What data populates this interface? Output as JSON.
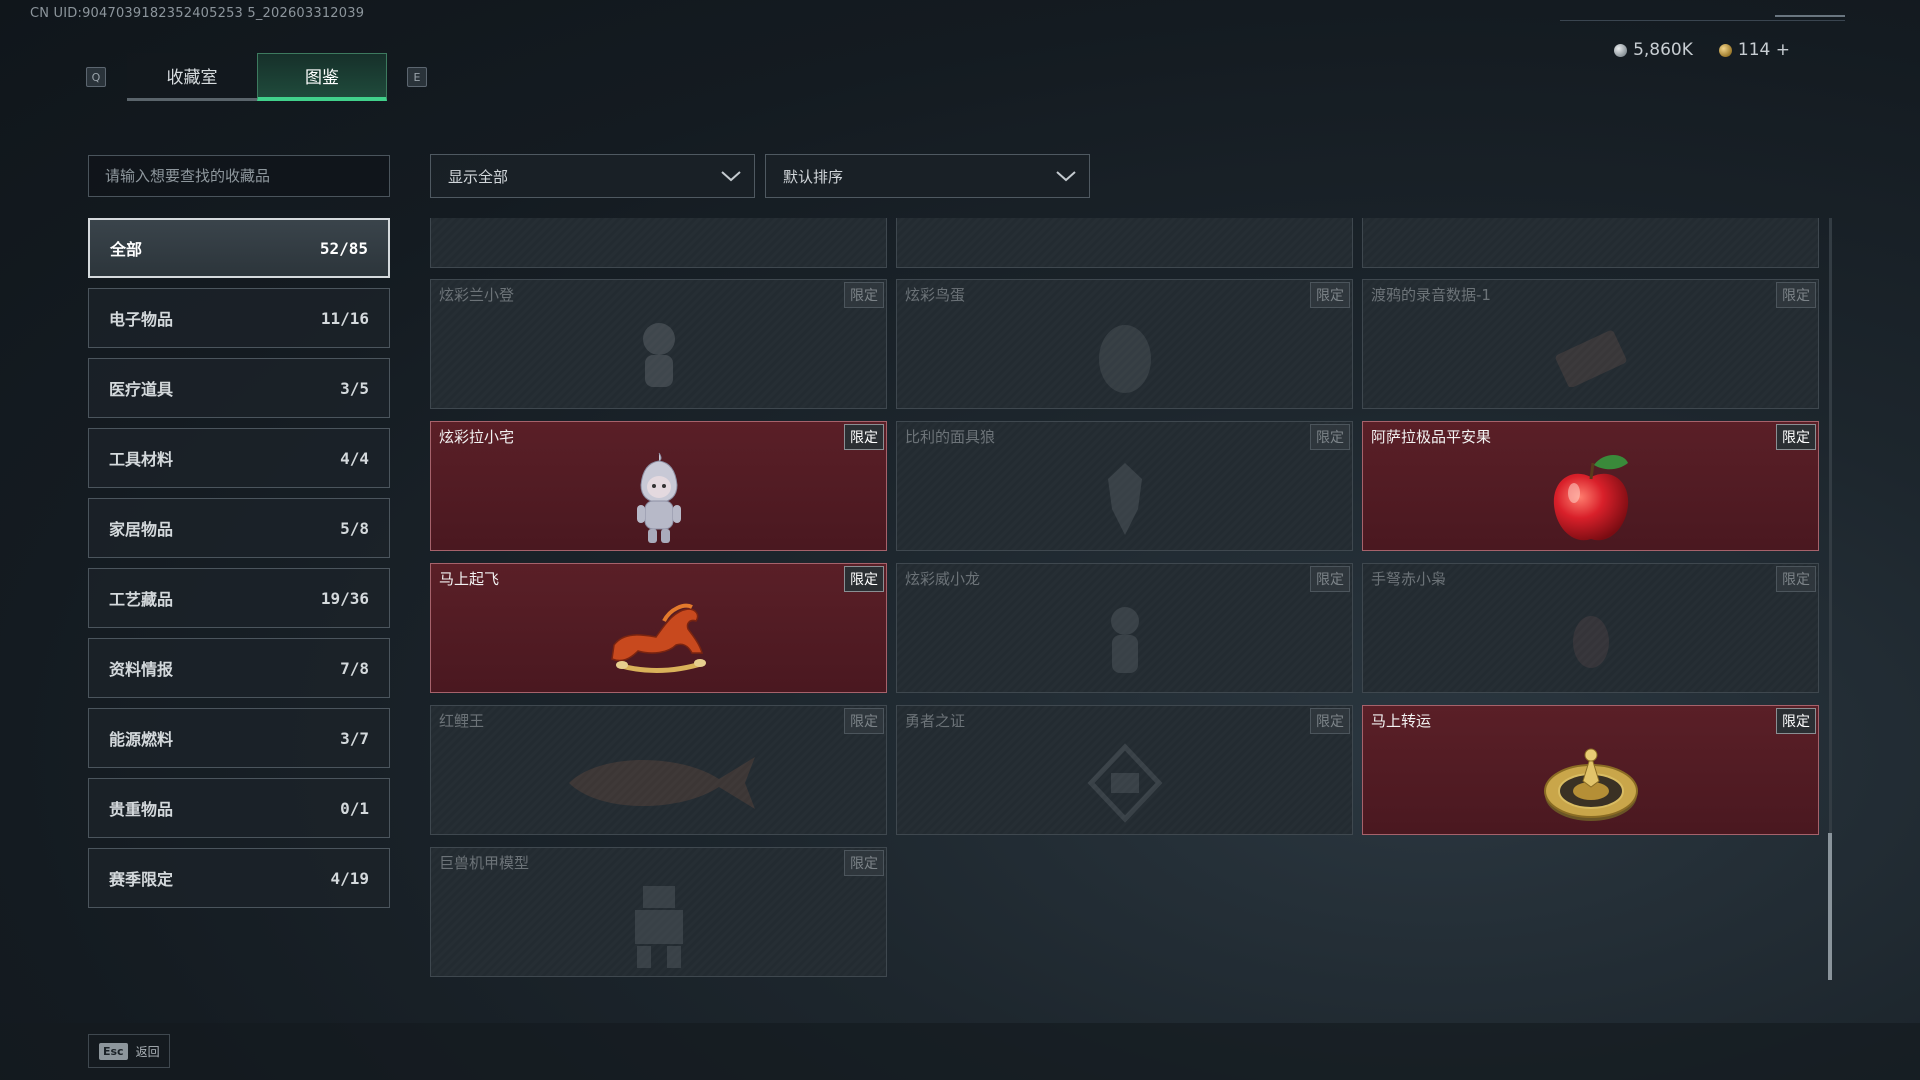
{
  "uid": "CN UID:9047039182352405253 5_202603312039",
  "tabs": {
    "left_key": "Q",
    "right_key": "E",
    "collection": "收藏室",
    "codex": "图鉴"
  },
  "currency": {
    "coin1": "5,860K",
    "coin2": "114 +"
  },
  "search": {
    "placeholder": "请输入想要查找的收藏品"
  },
  "filters": {
    "show": "显示全部",
    "sort": "默认排序"
  },
  "categories": [
    {
      "label": "全部",
      "count": "52/85",
      "active": true
    },
    {
      "label": "电子物品",
      "count": "11/16"
    },
    {
      "label": "医疗道具",
      "count": "3/5"
    },
    {
      "label": "工具材料",
      "count": "4/4"
    },
    {
      "label": "家居物品",
      "count": "5/8"
    },
    {
      "label": "工艺藏品",
      "count": "19/36"
    },
    {
      "label": "资料情报",
      "count": "7/8"
    },
    {
      "label": "能源燃料",
      "count": "3/7"
    },
    {
      "label": "贵重物品",
      "count": "0/1"
    },
    {
      "label": "赛季限定",
      "count": "4/19"
    }
  ],
  "items": [
    {
      "name": "炫彩兰小登",
      "badge": "限定",
      "owned": false,
      "icon": "doll-icon"
    },
    {
      "name": "炫彩鸟蛋",
      "badge": "限定",
      "owned": false,
      "icon": "egg-icon"
    },
    {
      "name": "渡鸦的录音数据-1",
      "badge": "限定",
      "owned": false,
      "icon": "recorder-icon"
    },
    {
      "name": "炫彩拉小宅",
      "badge": "限定",
      "owned": true,
      "icon": "figure-icon"
    },
    {
      "name": "比利的面具狼",
      "badge": "限定",
      "owned": false,
      "icon": "wolf-mask-icon"
    },
    {
      "name": "阿萨拉极品平安果",
      "badge": "限定",
      "owned": true,
      "icon": "apple-icon"
    },
    {
      "name": "马上起飞",
      "badge": "限定",
      "owned": true,
      "icon": "horse-icon"
    },
    {
      "name": "炫彩威小龙",
      "badge": "限定",
      "owned": false,
      "icon": "dragon-icon"
    },
    {
      "name": "手弩赤小枭",
      "badge": "限定",
      "owned": false,
      "icon": "owl-icon"
    },
    {
      "name": "红鲤王",
      "badge": "限定",
      "owned": false,
      "icon": "fish-icon"
    },
    {
      "name": "勇者之证",
      "badge": "限定",
      "owned": false,
      "icon": "medal-icon"
    },
    {
      "name": "马上转运",
      "badge": "限定",
      "owned": true,
      "icon": "compass-icon"
    },
    {
      "name": "巨兽机甲模型",
      "badge": "限定",
      "owned": false,
      "icon": "mech-icon"
    }
  ],
  "footer": {
    "esc_key": "Esc",
    "back_label": "返回"
  },
  "colors": {
    "accent": "#41d18b",
    "owned_card": "#5a1f27"
  }
}
